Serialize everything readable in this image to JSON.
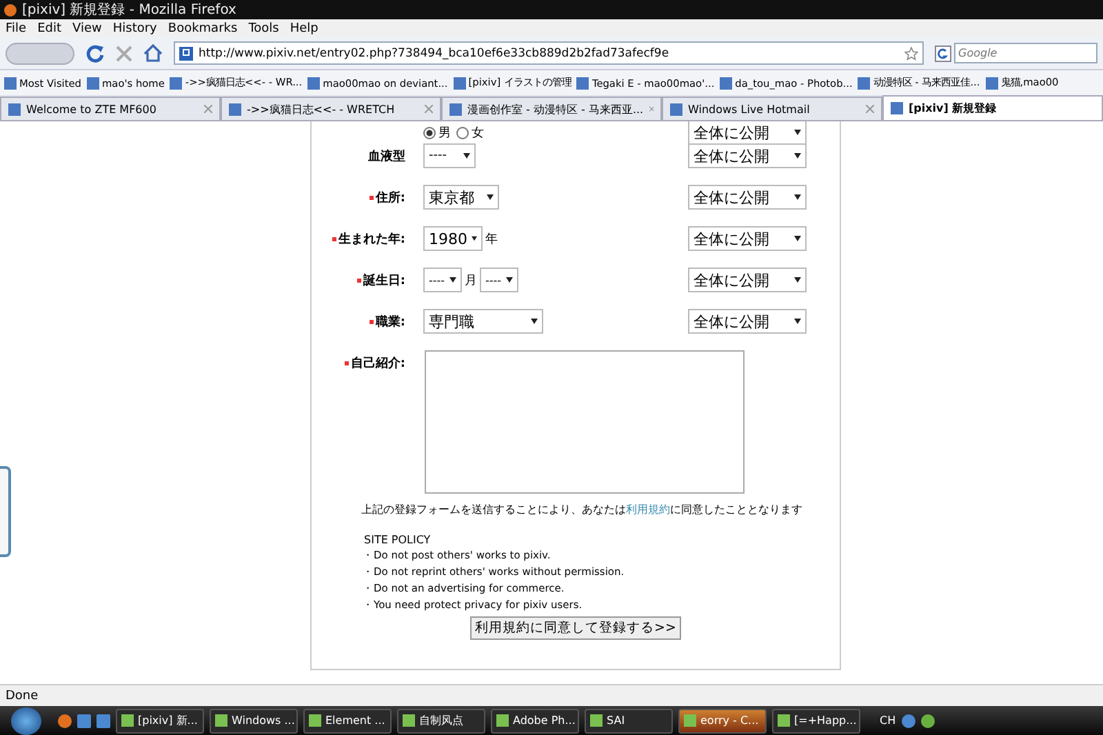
{
  "window": {
    "title": "[pixiv] 新規登録 - Mozilla Firefox"
  },
  "menu": [
    "File",
    "Edit",
    "View",
    "History",
    "Bookmarks",
    "Tools",
    "Help"
  ],
  "url": "http://www.pixiv.net/entry02.php?738494_bca10ef6e33cb889d2b2fad73afecf9e",
  "search": {
    "placeholder": "Google"
  },
  "bookmarks": [
    "Most Visited",
    "mao's home",
    "->>疯猫日志<<- - WR...",
    "mao00mao on deviant...",
    "[pixiv] イラストの管理",
    "Tegaki E - mao00mao'...",
    "da_tou_mao - Photob...",
    "动漫特区 - 马来西亚佳...",
    "鬼猫,mao00"
  ],
  "tabs": [
    {
      "label": "Welcome to ZTE MF600",
      "selected": false
    },
    {
      "label": "->>疯猫日志<<- - WRETCH",
      "selected": false
    },
    {
      "label": "漫画创作室 - 动漫特区 - 马来西亚...",
      "selected": false
    },
    {
      "label": "Windows Live Hotmail",
      "selected": false
    },
    {
      "label": "[pixiv] 新規登録",
      "selected": true
    }
  ],
  "form": {
    "rows": [
      {
        "kind": "radio",
        "options": [
          {
            "label": "男",
            "selected": true
          },
          {
            "label": "女",
            "selected": false
          }
        ],
        "visibility": "全体に公開"
      },
      {
        "kind": "select",
        "label": "血液型",
        "required": false,
        "selects": [
          {
            "value": "----"
          }
        ],
        "visibility": "全体に公開"
      },
      {
        "kind": "select",
        "label": "住所:",
        "required": true,
        "selects": [
          {
            "value": "東京都"
          }
        ],
        "visibility": "全体に公開"
      },
      {
        "kind": "select",
        "label": "生まれた年:",
        "required": true,
        "selects": [
          {
            "value": "1980",
            "suffix": "年"
          }
        ],
        "visibility": "全体に公開"
      },
      {
        "kind": "select",
        "label": "誕生日:",
        "required": true,
        "selects": [
          {
            "value": "----",
            "suffix": "月"
          },
          {
            "value": "----"
          }
        ],
        "visibility": "全体に公開"
      },
      {
        "kind": "select",
        "label": "職業:",
        "required": true,
        "selects": [
          {
            "value": "専門職"
          }
        ],
        "visibility": "全体に公開"
      },
      {
        "kind": "textarea",
        "label": "自己紹介:",
        "required": true
      }
    ],
    "agreement": {
      "before": "上記の登録フォームを送信することにより、あなたは",
      "link": "利用規約",
      "after": "に同意したこととなります"
    },
    "policy_title": "SITE POLICY",
    "policy": [
      "・Do not post others' works to pixiv.",
      "・Do not reprint others' works without permission.",
      "・Do not an advertising for commerce.",
      "・You need protect privacy for pixiv users."
    ],
    "submit": "利用規約に同意して登録する>>"
  },
  "status_bar": "Done",
  "taskbar": [
    {
      "label": "[pixiv] 新...",
      "selected": false
    },
    {
      "label": "Windows ...",
      "selected": false
    },
    {
      "label": "Element ...",
      "selected": false
    },
    {
      "label": "自制风点",
      "selected": false
    },
    {
      "label": "Adobe Ph...",
      "selected": false
    },
    {
      "label": "SAI",
      "selected": false
    },
    {
      "label": "eorry - C...",
      "selected": true
    },
    {
      "label": "[=+Happ...",
      "selected": false
    }
  ],
  "tray": {
    "language": "CH"
  }
}
